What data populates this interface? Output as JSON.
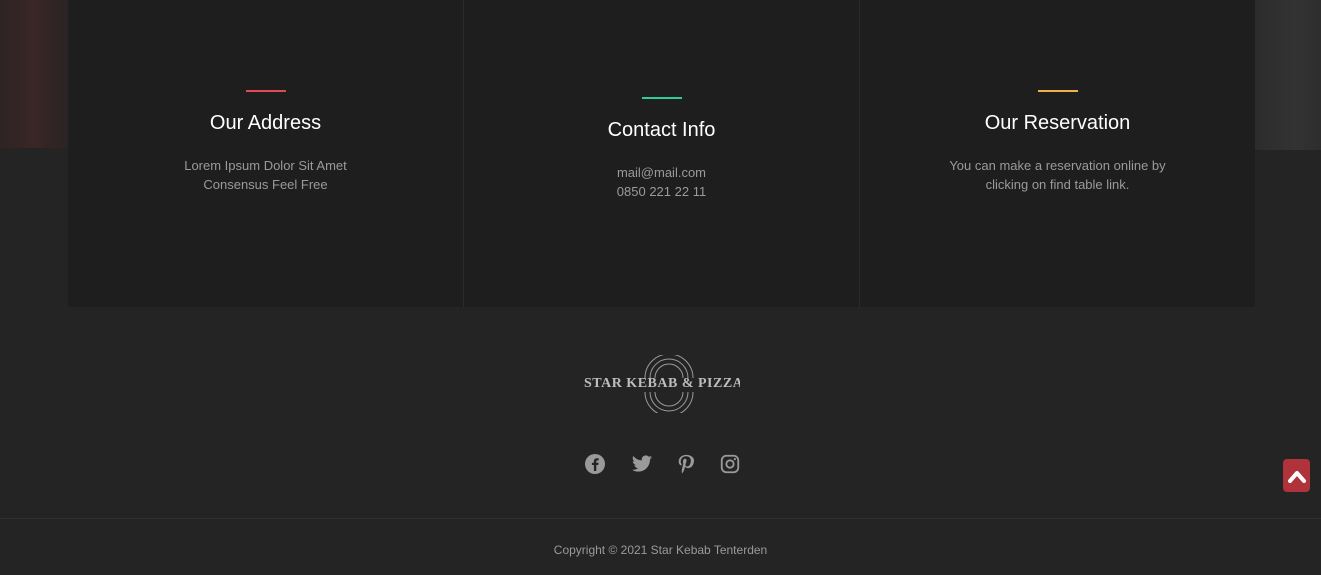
{
  "cards": [
    {
      "title": "Our Address",
      "lines": [
        "Lorem Ipsum Dolor Sit Amet",
        "Consensus Feel Free"
      ],
      "accent": "#e04a55"
    },
    {
      "title": "Contact Info",
      "lines": [
        "mail@mail.com",
        "0850 221 22 11"
      ],
      "accent": "#2ecc9a"
    },
    {
      "title": "Our Reservation",
      "lines": [
        "You can make a reservation online by",
        "clicking on find table link."
      ],
      "accent": "#f0b14a"
    }
  ],
  "logo": {
    "text": "STAR KEBAB & PIZZA",
    "icon": "circles-logo-icon"
  },
  "social": [
    {
      "name": "facebook-icon"
    },
    {
      "name": "twitter-icon"
    },
    {
      "name": "pinterest-icon"
    },
    {
      "name": "instagram-icon"
    }
  ],
  "footer": {
    "copyright": "Copyright © 2021 Star Kebab Tenterden"
  },
  "scroll_top": {
    "icon": "chevron-up-icon",
    "color": "#b0323a"
  }
}
